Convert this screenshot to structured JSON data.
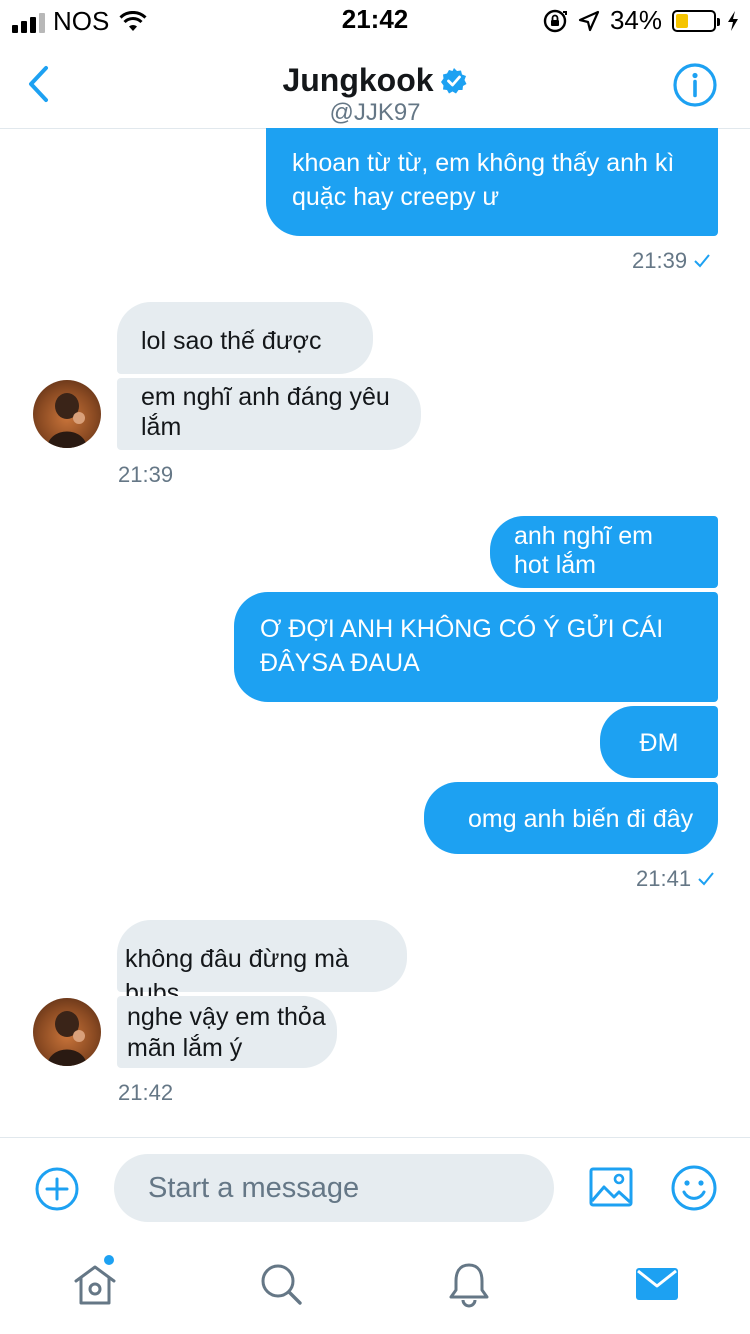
{
  "status_bar": {
    "carrier": "NOS",
    "time": "21:42",
    "battery_percent": "34%",
    "battery_level": 0.34,
    "icons": [
      "signal-icon",
      "wifi-icon",
      "orientation-lock-icon",
      "location-icon",
      "battery-icon",
      "charging-icon"
    ]
  },
  "header": {
    "display_name": "Jungkook",
    "handle": "@JJK97",
    "verified": true,
    "icons": [
      "back-chevron-icon",
      "verified-badge-icon",
      "info-icon"
    ]
  },
  "conversation": {
    "messages": [
      {
        "direction": "out",
        "text": "khoan từ từ, em không thấy anh kì quặc hay creepy ư"
      },
      {
        "direction": "in",
        "text": "lol sao thế được"
      },
      {
        "direction": "in",
        "text": "em nghĩ anh đáng yêu lắm"
      },
      {
        "direction": "out",
        "text": "anh nghĩ em hot lắm"
      },
      {
        "direction": "out",
        "text": "Ơ ĐỢI ANH KHÔNG CÓ Ý GỬI CÁI ĐÂYSA ĐAUA"
      },
      {
        "direction": "out",
        "text": "ĐM"
      },
      {
        "direction": "out",
        "text": "omg anh biến đi đây"
      },
      {
        "direction": "in",
        "text": "không đâu đừng mà bubs"
      },
      {
        "direction": "in",
        "text": "nghe vậy em thỏa mãn lắm ý"
      }
    ],
    "timestamps": [
      "21:39",
      "21:39",
      "21:41",
      "21:42"
    ]
  },
  "composer": {
    "placeholder": "Start a message",
    "value": ""
  },
  "tab_bar": {
    "tabs": [
      "home-icon",
      "search-icon",
      "notifications-icon",
      "messages-icon"
    ],
    "active": "messages-icon"
  },
  "colors": {
    "accent": "#1da1f2",
    "incoming_bubble": "#e6ecf0",
    "muted_text": "#657786",
    "battery_fill": "#f5c400"
  }
}
